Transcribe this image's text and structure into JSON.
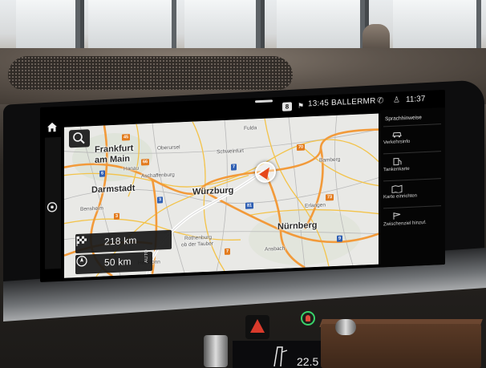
{
  "status_bar": {
    "badge": "8",
    "destination": "13:45 BALLERMR",
    "clock": "11:37"
  },
  "map": {
    "cities": [
      {
        "name": "Frankfurt",
        "size": "big"
      },
      {
        "name": "am Main",
        "size": "big"
      },
      {
        "name": "Darmstadt",
        "size": "big"
      },
      {
        "name": "Würzburg",
        "size": "big"
      },
      {
        "name": "Nürnberg",
        "size": "big"
      }
    ],
    "towns": [
      "Oberursel",
      "Hanau",
      "Aschaffenburg",
      "Schweinfurt",
      "Bamberg",
      "Rothenburg",
      "ob der Tauber",
      "Heilbronn",
      "Ansbach",
      "Erlangen",
      "Bensheim",
      "Fulda"
    ],
    "road_numbers": [
      "45",
      "66",
      "3",
      "7",
      "70",
      "73",
      "81",
      "6",
      "9",
      "3",
      "7"
    ]
  },
  "cards": {
    "destination_distance": "218 km",
    "next_distance": "50 km",
    "auto_label": "AUTO"
  },
  "side_menu": {
    "title": "Sprachhinweise",
    "items": [
      {
        "label": "Verkehrsinfo",
        "icon": "car-icon"
      },
      {
        "label": "Tankenkarte",
        "icon": "fuel-icon"
      },
      {
        "label": "Karte einrichten",
        "icon": "map-settings-icon"
      },
      {
        "label": "Zwischenziel hinzuf.",
        "icon": "waypoint-icon"
      }
    ]
  },
  "climate": {
    "temperature": "22.5"
  },
  "colors": {
    "route_line": "#ffffff",
    "motorway": "#f29a3a",
    "vehicle_arrow": "#e64618",
    "hazard": "#d93a2b",
    "airbag_ring": "#38d26a"
  }
}
